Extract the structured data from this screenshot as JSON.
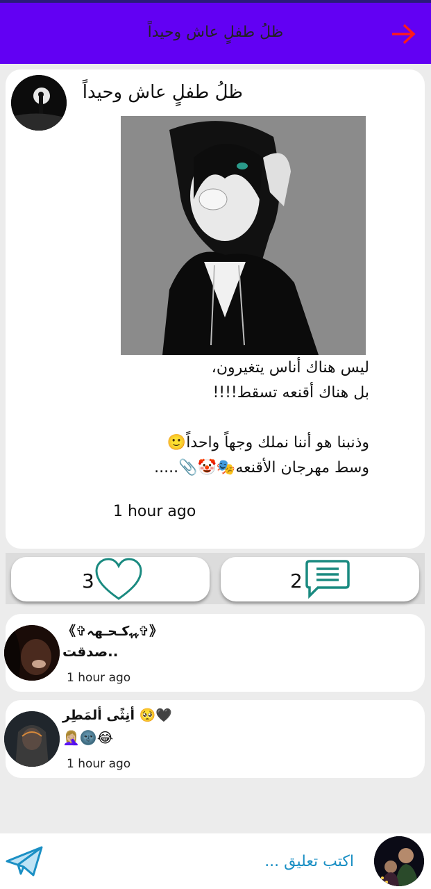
{
  "header": {
    "title": "ظلُ طفلٍ عاش وحيداً"
  },
  "post": {
    "author": "ظلُ طفلٍ عاش وحيداً",
    "text_lines": [
      "ليس هناك أناس يتغيرون،",
      "بل هناك أقنعه تسقط!!!!",
      "",
      "وذنبنا هو أننا نملك وجهاً واحداً🙂",
      "وسط مهرجان الأقنعه🎭🤡📎....."
    ],
    "time": "1 hour ago",
    "likes": "3",
    "comments": "2"
  },
  "comments": [
    {
      "name": "《✞ﮩﮩکـحـهہ✞》",
      "body": "صدقت..",
      "time": "1 hour ago"
    },
    {
      "name": "أنِثًى ألمَطِر 🥺🖤",
      "body": "🤦🏼‍♀️🌚😂",
      "time": "1 hour ago"
    }
  ],
  "composer": {
    "placeholder": "اكتب تعليق ..."
  },
  "colors": {
    "topbar": "#6200f3",
    "accent": "#1a8a80",
    "arrow": "#ff1a1a",
    "link": "#1a8fc4"
  }
}
